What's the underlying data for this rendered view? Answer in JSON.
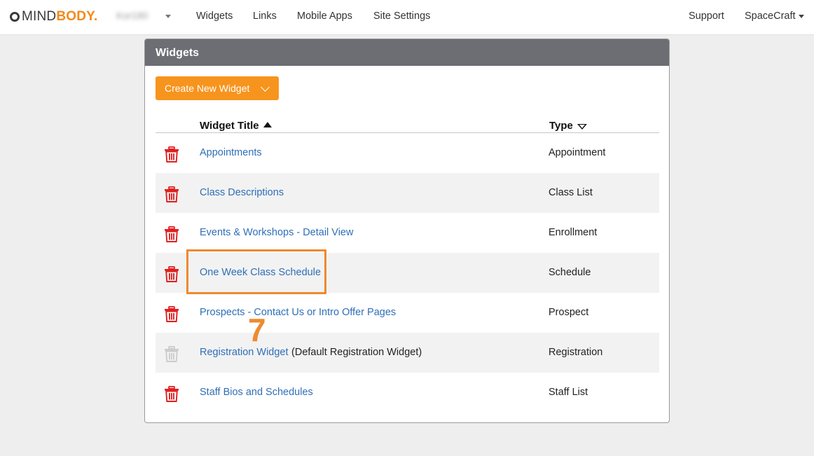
{
  "brand": {
    "logo_mind": "MIND",
    "logo_body": "BODY.",
    "accent": "#f28a1a"
  },
  "topnav": {
    "site_name": "Kor180",
    "items": [
      {
        "label": "Widgets"
      },
      {
        "label": "Links"
      },
      {
        "label": "Mobile Apps"
      },
      {
        "label": "Site Settings"
      }
    ],
    "support": "Support",
    "account": "SpaceCraft"
  },
  "panel": {
    "title": "Widgets",
    "create_button": "Create New Widget",
    "columns": {
      "title": "Widget Title",
      "type": "Type"
    },
    "rows": [
      {
        "title": "Appointments",
        "note": "",
        "type": "Appointment",
        "deletable": true
      },
      {
        "title": "Class Descriptions",
        "note": "",
        "type": "Class List",
        "deletable": true
      },
      {
        "title": "Events & Workshops - Detail View",
        "note": "",
        "type": "Enrollment",
        "deletable": true
      },
      {
        "title": "One Week Class Schedule",
        "note": "",
        "type": "Schedule",
        "deletable": true
      },
      {
        "title": "Prospects - Contact Us or Intro Offer Pages",
        "note": "",
        "type": "Prospect",
        "deletable": true
      },
      {
        "title": "Registration Widget",
        "note": " (Default Registration Widget)",
        "type": "Registration",
        "deletable": false
      },
      {
        "title": "Staff Bios and Schedules",
        "note": "",
        "type": "Staff List",
        "deletable": true
      }
    ]
  },
  "annotation": {
    "step_number": "7",
    "color": "#ee8a2f"
  },
  "colors": {
    "link": "#2f6fb7",
    "trash_active": "#e02020",
    "trash_disabled": "#cccccc",
    "button": "#f7941d",
    "panel_header": "#6c6e73"
  }
}
